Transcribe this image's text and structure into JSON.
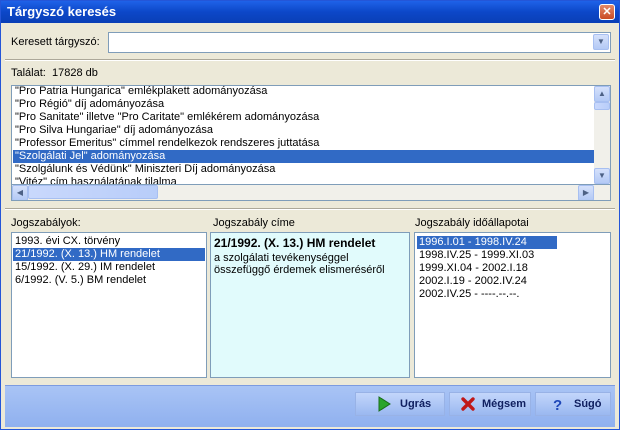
{
  "window": {
    "title": "Tárgyszó keresés",
    "close_glyph": "✕"
  },
  "search": {
    "label": "Keresett tárgyszó:",
    "value": ""
  },
  "result": {
    "label": "Találat:",
    "count": "17828 db"
  },
  "results_list": {
    "items": [
      "\"Pro Patria Hungarica\" emlékplakett adományozása",
      "\"Pro Régió\" díj adományozása",
      "\"Pro Sanitate\" illetve \"Pro Caritate\" emlékérem adományozása",
      "\"Pro Silva Hungariae\" díj adományozása",
      "\"Professor Emeritus\" címmel rendelkezok rendszeres juttatása",
      "\"Szolgálati Jel\" adományozása",
      "\"Szolgálunk és Védünk\" Miniszteri Díj adományozása",
      "\"Vitéz\" cím használatának tilalma"
    ],
    "selected_index": 5
  },
  "jogszabalyok": {
    "label": "Jogszabályok:",
    "items": [
      "1993. évi CX. törvény",
      "21/1992. (X. 13.) HM rendelet",
      "15/1992. (X. 29.) IM rendelet",
      "6/1992. (V. 5.) BM rendelet"
    ],
    "selected_index": 1
  },
  "cim": {
    "label": "Jogszabály címe",
    "heading": "21/1992. (X. 13.) HM rendelet",
    "body": "a szolgálati tevékenységgel összefüggő érdemek elismeréséről"
  },
  "idoallapot": {
    "label": "Jogszabály időállapotai",
    "items": [
      "1996.I.01 - 1998.IV.24",
      "1998.IV.25 - 1999.XI.03",
      "1999.XI.04 - 2002.I.18",
      "2002.I.19 - 2002.IV.24",
      "2002.IV.25 - ----.--.--."
    ],
    "selected_index": 0
  },
  "buttons": {
    "ugras": "Ugrás",
    "megsem": "Mégsem",
    "sugo": "Súgó"
  },
  "colors": {
    "titlebar": "#0c47c8",
    "selection": "#316ac5",
    "info_bg": "#e1fbfc",
    "footer": "#a9c4f5"
  }
}
